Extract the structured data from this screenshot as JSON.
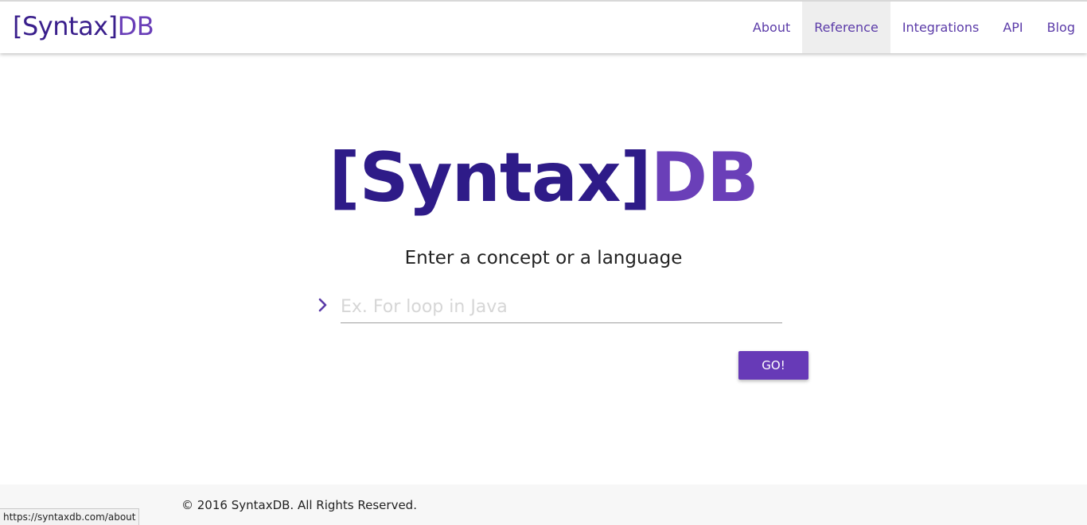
{
  "header": {
    "brand": {
      "syntax": "[Syntax]",
      "db": "DB"
    },
    "nav": [
      {
        "label": "About"
      },
      {
        "label": "Reference",
        "active": true
      },
      {
        "label": "Integrations"
      },
      {
        "label": "API"
      },
      {
        "label": "Blog"
      }
    ]
  },
  "main": {
    "logo": {
      "syntax": "[Syntax]",
      "db": "DB"
    },
    "tagline": "Enter a concept or a language",
    "search": {
      "placeholder": "Ex. For loop in Java",
      "value": "",
      "icon": "chevron-right-icon"
    },
    "go_label": "GO!"
  },
  "footer": {
    "copyright": "© 2016 SyntaxDB. All Rights Reserved."
  },
  "status_bar": {
    "url": "https://syntaxdb.com/about"
  },
  "colors": {
    "brand_dark": "#2e1b88",
    "brand_purple": "#6a3fb8",
    "button": "#673ab7",
    "nav_active_bg": "#eeeeee"
  }
}
